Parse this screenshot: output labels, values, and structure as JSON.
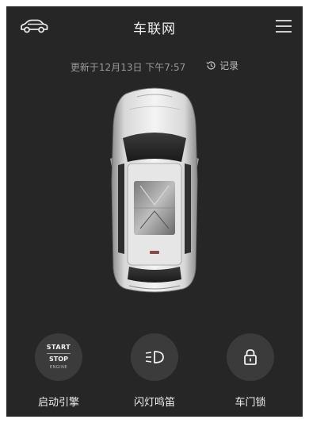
{
  "header": {
    "title": "车联网",
    "left_icon": "car-icon",
    "right_icon": "menu-icon"
  },
  "status": {
    "updated_text": "更新于12月13日 下午7:57",
    "history_label": "记录",
    "history_icon": "history-clock-icon"
  },
  "vehicle": {
    "image": "car-top-view"
  },
  "actions": [
    {
      "label": "启动引擎",
      "icon": "start-stop-engine-icon",
      "icon_text": {
        "line1": "START",
        "line2": "STOP",
        "line3": "ENGINE"
      }
    },
    {
      "label": "闪灯鸣笛",
      "icon": "headlight-flash-icon"
    },
    {
      "label": "车门锁",
      "icon": "lock-icon"
    }
  ],
  "colors": {
    "background": "#262626",
    "button": "#3b3b3b",
    "text": "#f0f0f0",
    "muted_text": "#9a9a9a"
  }
}
